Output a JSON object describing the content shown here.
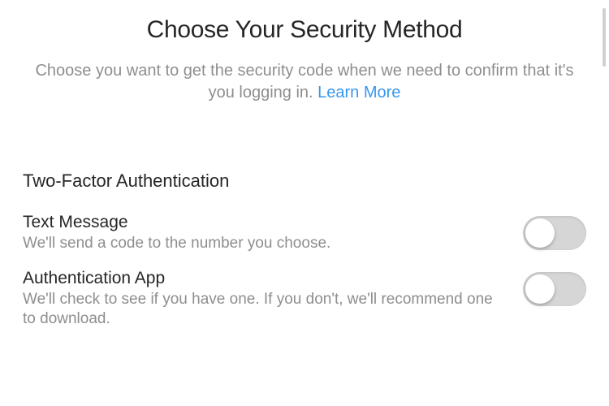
{
  "header": {
    "title": "Choose Your Security Method",
    "desc_prefix": "Choose you want to get the security code when we need to confirm that it's you logging in. ",
    "learn_more": "Learn More"
  },
  "section": {
    "title": "Two-Factor Authentication"
  },
  "options": [
    {
      "title": "Text Message",
      "desc": "We'll send a code to the number you choose."
    },
    {
      "title": "Authentication App",
      "desc": "We'll check to see if you have one. If you don't, we'll recommend one to download."
    }
  ]
}
